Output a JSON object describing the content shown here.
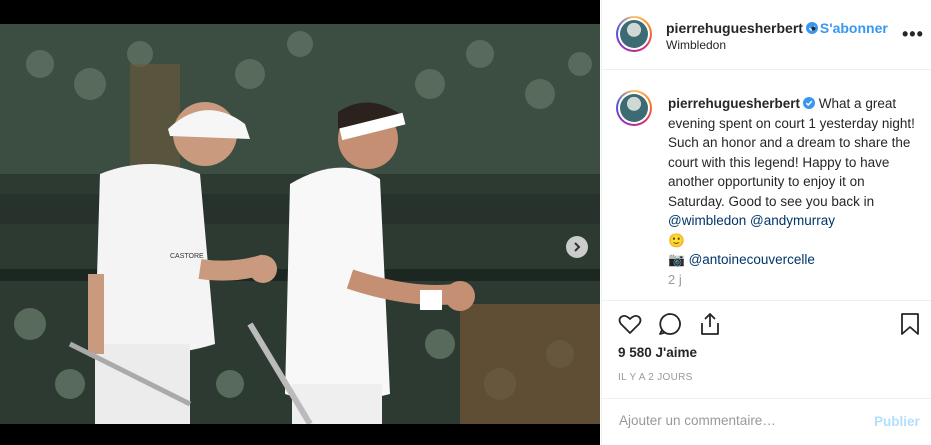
{
  "post": {
    "username": "pierrehuguesherbert",
    "follow_label": "S'abonner",
    "follow_separator": "•",
    "location": "Wimbledon",
    "more_label": "•••"
  },
  "caption": {
    "username": "pierrehuguesherbert",
    "text": " What a great evening spent on court 1 yesterday night! Such an honor and a dream to share the court with this legend! Happy to have another opportunity to enjoy it on Saturday. Good to see you back in ",
    "mention1": "@wimbledon",
    "mention2": "@andymurray",
    "emoji": "🙂",
    "camera": "📷",
    "mention3": "@antoinecouvercelle",
    "time": "2 j"
  },
  "stats": {
    "likes": "9 580 J'aime",
    "ago": "IL Y A 2 JOURS"
  },
  "comment_box": {
    "placeholder": "Ajouter un commentaire…",
    "publish_label": "Publier"
  },
  "photo": {
    "player_left_shirt_text": "CASTORE",
    "image_index": 1,
    "image_count": 2
  },
  "colors": {
    "accent": "#3897f0",
    "link": "#003569",
    "muted": "#999999"
  }
}
